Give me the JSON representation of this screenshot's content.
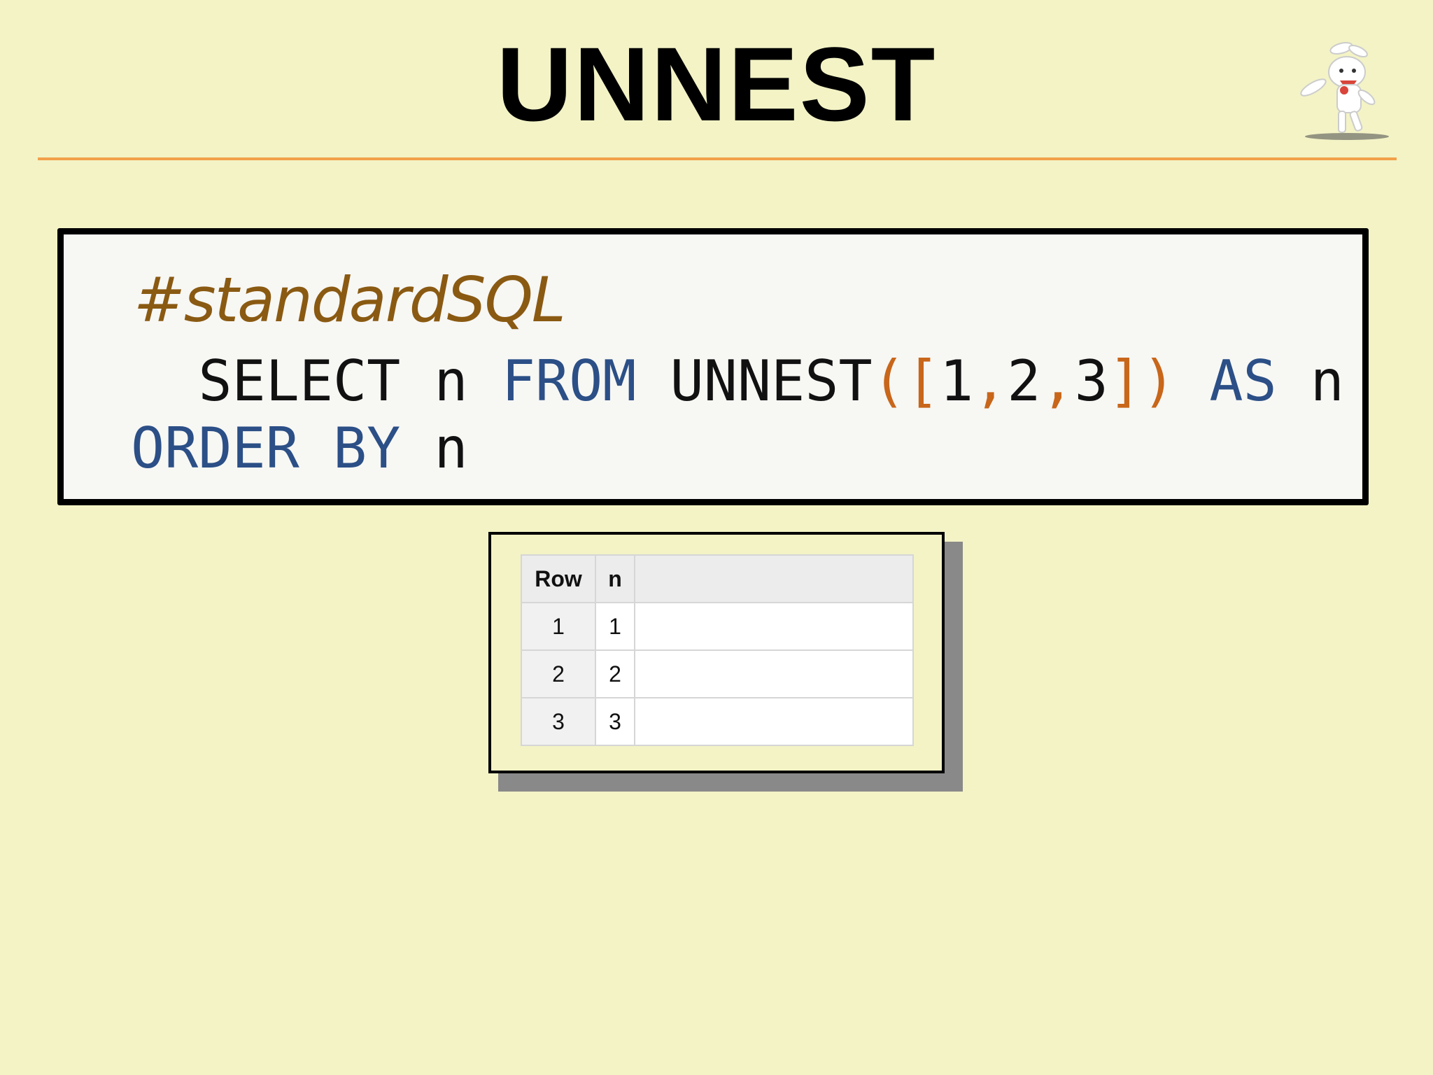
{
  "slide": {
    "title": "UNNEST",
    "accent_color": "#f2a04a",
    "background_color": "#f3f3c6",
    "mascot_icon": "rabbit-mascot-icon"
  },
  "code": {
    "comment": "#standardSQL",
    "line1": [
      {
        "text": "  SELECT n ",
        "type": "plain"
      },
      {
        "text": "FROM",
        "type": "keyword"
      },
      {
        "text": " UNNEST",
        "type": "plain"
      },
      {
        "text": "([",
        "type": "punct"
      },
      {
        "text": "1",
        "type": "plain"
      },
      {
        "text": ",",
        "type": "punct"
      },
      {
        "text": "2",
        "type": "plain"
      },
      {
        "text": ",",
        "type": "punct"
      },
      {
        "text": "3",
        "type": "plain"
      },
      {
        "text": "])",
        "type": "punct"
      },
      {
        "text": " ",
        "type": "plain"
      },
      {
        "text": "AS",
        "type": "keyword"
      },
      {
        "text": " n",
        "type": "plain"
      }
    ],
    "line2": [
      {
        "text": "ORDER BY",
        "type": "keyword"
      },
      {
        "text": " n",
        "type": "plain"
      }
    ]
  },
  "result": {
    "headers": [
      "Row",
      "n",
      ""
    ],
    "rows": [
      [
        "1",
        "1",
        ""
      ],
      [
        "2",
        "2",
        ""
      ],
      [
        "3",
        "3",
        ""
      ]
    ]
  }
}
